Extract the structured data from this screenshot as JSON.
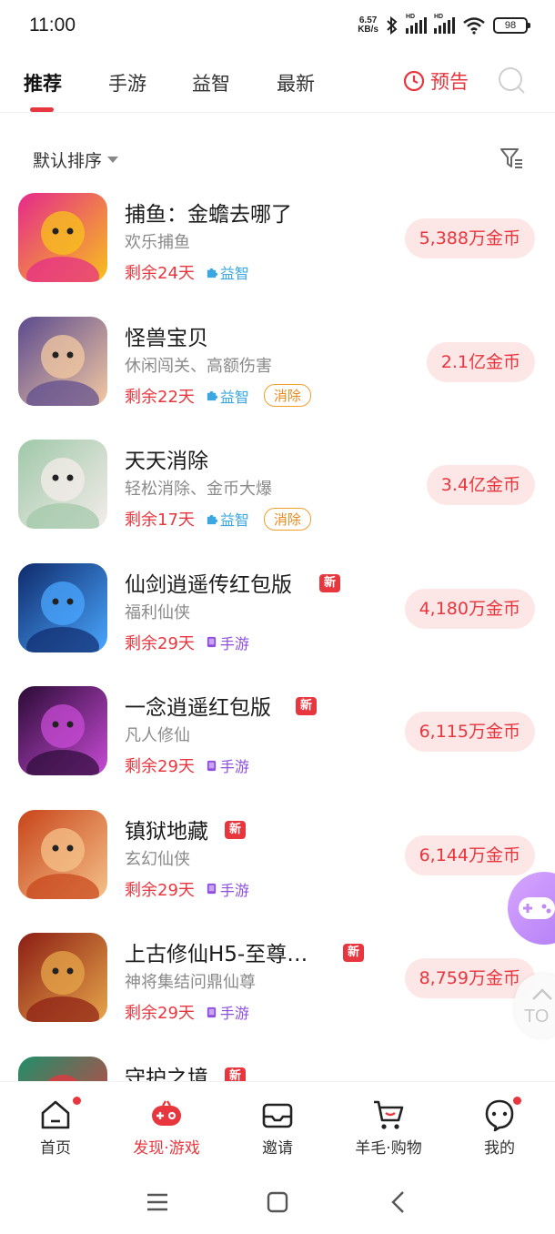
{
  "status": {
    "time": "11:00",
    "net_speed_value": "6.57",
    "net_speed_unit": "KB/s",
    "signal_label": "HD",
    "battery": "98"
  },
  "tabs": [
    {
      "label": "推荐"
    },
    {
      "label": "手游"
    },
    {
      "label": "益智"
    },
    {
      "label": "最新"
    }
  ],
  "preview_label": "预告",
  "sort_label": "默认排序",
  "games": [
    {
      "title": "捕鱼：金蟾去哪了",
      "subtitle": "欢乐捕鱼",
      "days": "剩余24天",
      "category": "益智",
      "category_type": "puzzle",
      "tag": "",
      "is_new": false,
      "reward": "5,388万金币",
      "icon": "fish-game-icon",
      "palette": [
        "#e6288c",
        "#f7c21b"
      ]
    },
    {
      "title": "怪兽宝贝",
      "subtitle": "休闲闯关、高额伤害",
      "days": "剩余22天",
      "category": "益智",
      "category_type": "puzzle",
      "tag": "消除",
      "is_new": false,
      "reward": "2.1亿金币",
      "icon": "monster-game-icon",
      "palette": [
        "#5b4a8e",
        "#f3c9a2"
      ]
    },
    {
      "title": "天天消除",
      "subtitle": "轻松消除、金币大爆",
      "days": "剩余17天",
      "category": "益智",
      "category_type": "puzzle",
      "tag": "消除",
      "is_new": false,
      "reward": "3.4亿金币",
      "icon": "monkey-game-icon",
      "palette": [
        "#9fc8a8",
        "#f4ecea"
      ]
    },
    {
      "title": "仙剑逍遥传红包版",
      "subtitle": "福利仙侠",
      "days": "剩余29天",
      "category": "手游",
      "category_type": "mobile",
      "tag": "",
      "is_new": true,
      "new_label": "新",
      "reward": "4,180万金币",
      "icon": "sword-hero-game-icon",
      "palette": [
        "#0f2a6b",
        "#4aa7ff"
      ]
    },
    {
      "title": "一念逍遥红包版",
      "subtitle": "凡人修仙",
      "days": "剩余29天",
      "category": "手游",
      "category_type": "mobile",
      "tag": "",
      "is_new": true,
      "new_label": "新",
      "reward": "6,115万金币",
      "icon": "immortal-game-icon",
      "palette": [
        "#2a0b35",
        "#c84bd6"
      ]
    },
    {
      "title": "镇狱地藏",
      "subtitle": "玄幻仙侠",
      "days": "剩余29天",
      "category": "手游",
      "category_type": "mobile",
      "tag": "",
      "is_new": true,
      "new_label": "新",
      "reward": "6,144万金币",
      "icon": "monk-game-icon",
      "palette": [
        "#c8451a",
        "#f5c189"
      ]
    },
    {
      "title": "上古修仙H5-至尊…",
      "subtitle": "神将集结问鼎仙尊",
      "days": "剩余29天",
      "category": "手游",
      "category_type": "mobile",
      "tag": "",
      "is_new": true,
      "new_label": "新",
      "reward": "8,759万金币",
      "icon": "ancient-immortal-game-icon",
      "palette": [
        "#8c1d14",
        "#e6a64a"
      ]
    },
    {
      "title": "守护之境",
      "subtitle": "",
      "days": "",
      "category": "",
      "category_type": "",
      "tag": "",
      "is_new": true,
      "new_label": "新",
      "reward": "",
      "icon": "guardian-game-icon",
      "palette": [
        "#1f8f6a",
        "#e8363e"
      ]
    }
  ],
  "float_top_label": "TO",
  "bottom_nav": [
    {
      "label": "首页",
      "icon": "home-icon",
      "active": false,
      "dot": true
    },
    {
      "label": "发现·游戏",
      "icon": "gamepad-icon",
      "active": true,
      "dot": false
    },
    {
      "label": "邀请",
      "icon": "envelope-icon",
      "active": false,
      "dot": false
    },
    {
      "label": "羊毛·购物",
      "icon": "cart-icon",
      "active": false,
      "dot": false
    },
    {
      "label": "我的",
      "icon": "profile-icon",
      "active": false,
      "dot": true
    }
  ],
  "colors": {
    "accent": "#e8363e",
    "puzzle": "#3aa7e0",
    "mobile": "#8e4fe0",
    "tag": "#e9891b",
    "coin_bg": "#fde6e6"
  }
}
